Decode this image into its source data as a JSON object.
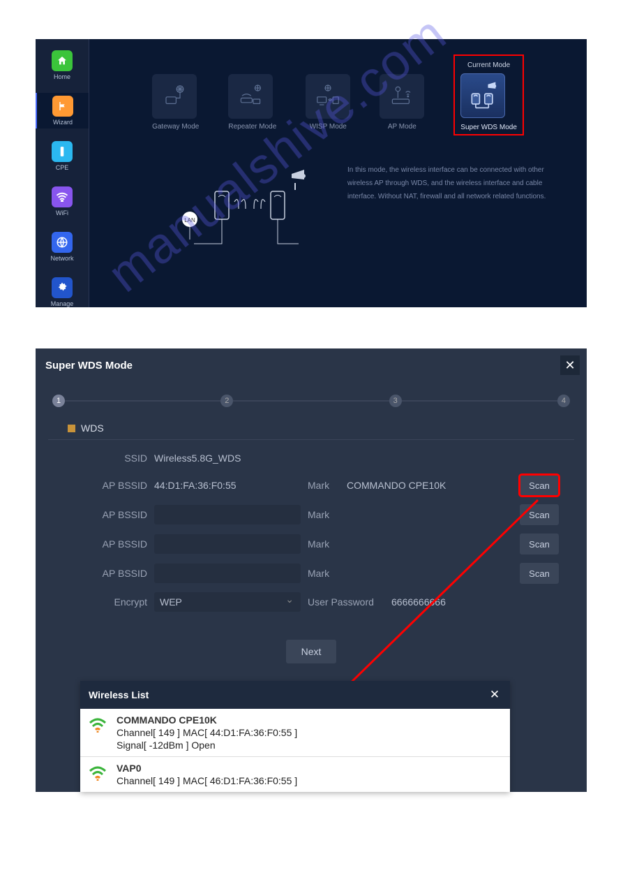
{
  "sidebar": {
    "items": [
      {
        "label": "Home"
      },
      {
        "label": "Wizard"
      },
      {
        "label": "CPE"
      },
      {
        "label": "WiFi"
      },
      {
        "label": "Network"
      },
      {
        "label": "Manage"
      }
    ]
  },
  "modes": {
    "current_label": "Current Mode",
    "items": [
      {
        "label": "Gateway Mode"
      },
      {
        "label": "Repeater Mode"
      },
      {
        "label": "WISP Mode"
      },
      {
        "label": "AP Mode"
      },
      {
        "label": "Super WDS Mode"
      }
    ]
  },
  "description": "In this mode, the wireless interface can be connected with other wireless AP through WDS, and the wireless interface and cable interface. Without NAT, firewall and all network related functions.",
  "diagram": {
    "lan_label": "LAN"
  },
  "modal": {
    "title": "Super WDS Mode",
    "section": "WDS",
    "fields": {
      "ssid_label": "SSID",
      "ssid_value": "Wireless5.8G_WDS",
      "bssid_label": "AP BSSID",
      "mark_label": "Mark",
      "encrypt_label": "Encrypt",
      "encrypt_value": "WEP",
      "pwd_label": "User Password",
      "pwd_value": "6666666666",
      "rows": [
        {
          "bssid": "44:D1:FA:36:F0:55",
          "mark": "COMMANDO CPE10K"
        },
        {
          "bssid": "",
          "mark": ""
        },
        {
          "bssid": "",
          "mark": ""
        },
        {
          "bssid": "",
          "mark": ""
        }
      ]
    },
    "scan": "Scan",
    "next": "Next"
  },
  "wlist": {
    "title": "Wireless List",
    "items": [
      {
        "name": "COMMANDO CPE10K",
        "line1": "Channel[ 149 ]   MAC[ 44:D1:FA:36:F0:55 ]",
        "line2": "Signal[ -12dBm ]   Open"
      },
      {
        "name": "VAP0",
        "line1": "Channel[ 149 ]   MAC[ 46:D1:FA:36:F0:55 ]",
        "line2": ""
      }
    ]
  },
  "watermark": "manualshive.com"
}
